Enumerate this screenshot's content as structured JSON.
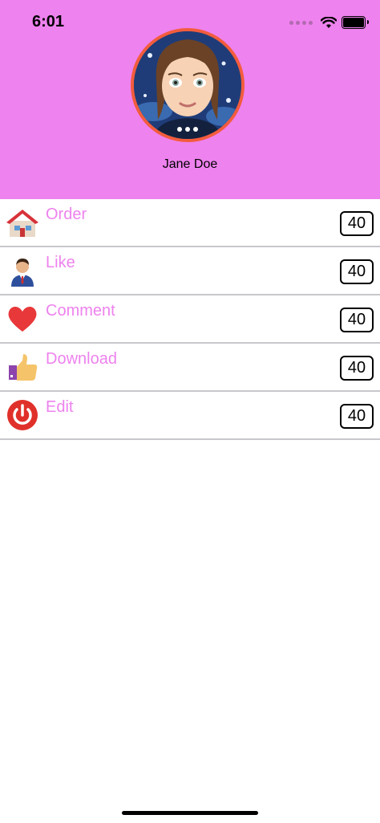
{
  "status_bar": {
    "time": "6:01",
    "signal_icon": "cellular-dots-icon",
    "wifi_icon": "wifi-icon",
    "battery_icon": "battery-icon"
  },
  "profile": {
    "name": "Jane Doe",
    "avatar_icon": "cartoon-woman-avatar",
    "header_color": "#ee82ee",
    "avatar_border_color": "#f25c3d"
  },
  "menu": {
    "label_color": "#ee82ee",
    "items": [
      {
        "label": "Order",
        "icon": "house-icon",
        "count": "40"
      },
      {
        "label": "Like",
        "icon": "person-icon",
        "count": "40"
      },
      {
        "label": "Comment",
        "icon": "heart-icon",
        "count": "40"
      },
      {
        "label": "Download",
        "icon": "thumbs-up-icon",
        "count": "40"
      },
      {
        "label": "Edit",
        "icon": "power-icon",
        "count": "40"
      }
    ]
  }
}
